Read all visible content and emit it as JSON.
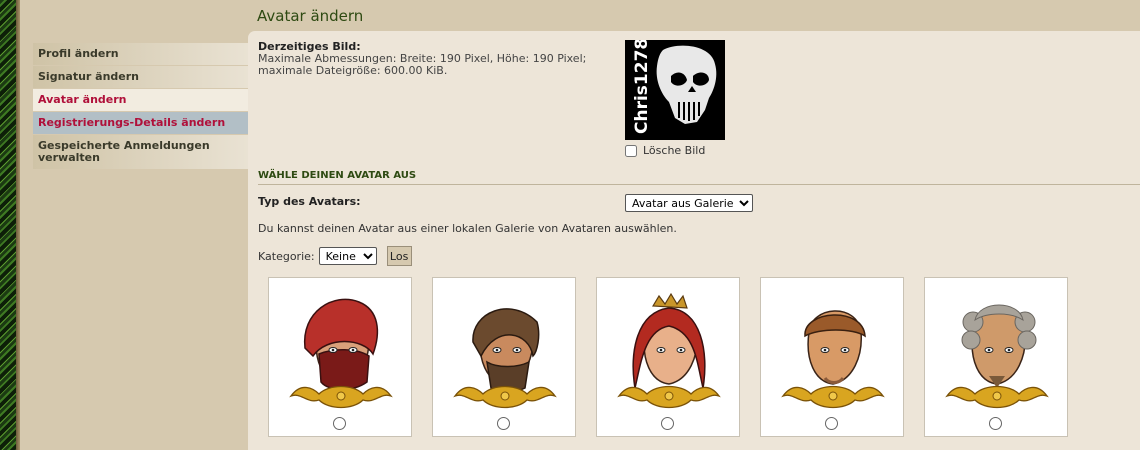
{
  "page": {
    "title": "Avatar ändern"
  },
  "nav": {
    "items": [
      {
        "label": "Profil ändern"
      },
      {
        "label": "Signatur ändern"
      },
      {
        "label": "Avatar ändern"
      },
      {
        "label": "Registrierungs-Details ändern"
      },
      {
        "label": "Gespeicherte Anmeldungen verwalten"
      }
    ],
    "active_index": 2
  },
  "current": {
    "label": "Derzeitiges Bild:",
    "line1": "Maximale Abmessungen: Breite: 190 Pixel, Höhe: 190 Pixel;",
    "line2": "maximale Dateigröße: 600.00 KiB.",
    "avatar_text": "Chris1278",
    "delete_label": "Lösche Bild"
  },
  "choose": {
    "heading": "WÄHLE DEINEN AVATAR AUS",
    "type_label": "Typ des Avatars:",
    "type_value": "Avatar aus Galerie",
    "description": "Du kannst deinen Avatar aus einer lokalen Galerie von Avataren auswählen.",
    "category_label": "Kategorie:",
    "category_value": "Keine",
    "go_label": "Los"
  },
  "gallery": [
    {
      "icon": "red-hooded-assassin-avatar",
      "hair": "#b8302a",
      "skin": "#d9a07a",
      "accent": "#7a1a18"
    },
    {
      "icon": "bearded-man-avatar",
      "hair": "#6b4a2e",
      "skin": "#c98a5e",
      "accent": "#5a3e28"
    },
    {
      "icon": "red-haired-queen-avatar",
      "hair": "#b32a20",
      "skin": "#e8b08a",
      "accent": "#c9962a"
    },
    {
      "icon": "bowl-cut-man-avatar",
      "hair": "#9a5a2a",
      "skin": "#d89a66",
      "accent": "#8a5a3a"
    },
    {
      "icon": "powdered-wig-noble-avatar",
      "hair": "#a8a39a",
      "skin": "#cf9a6a",
      "accent": "#7a5a3a"
    }
  ]
}
